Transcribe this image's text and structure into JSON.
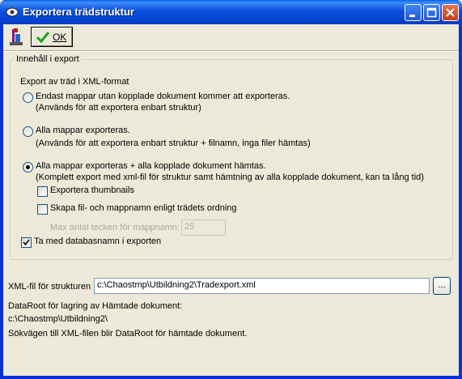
{
  "window": {
    "title": "Exportera trädstruktur",
    "minimize_icon": "minimize-icon",
    "maximize_icon": "maximize-icon",
    "close_icon": "close-icon"
  },
  "toolbar": {
    "tool_icon": "export-tool-icon",
    "ok_label": "OK",
    "ok_icon": "checkmark-icon"
  },
  "group": {
    "legend": "Innehåll i export",
    "heading": "Export av träd i XML-format",
    "options": [
      {
        "label": "Endast mappar utan kopplade dokument kommer att exporteras.",
        "note": "(Används för att exportera enbart struktur)",
        "selected": false
      },
      {
        "label": "Alla mappar exporteras.",
        "note": "(Används för att exportera enbart struktur + filnamn, inga filer hämtas)",
        "selected": false
      },
      {
        "label": "Alla mappar exporteras + alla kopplade dokument hämtas.",
        "note": "(Komplett export med xml-fil för struktur samt hämtning av alla kopplade dokument, kan ta lång tid)",
        "selected": true
      }
    ],
    "thumbnails_label": "Exportera thumbnails",
    "thumbnails_checked": false,
    "naming_label": "Skapa fil- och mappnamn enligt trädets ordning",
    "naming_checked": false,
    "max_chars_label": "Max antal tecken för mappnamn:",
    "max_chars_value": "25",
    "dbname_label": "Ta med databasnamn i exporten",
    "dbname_checked": true
  },
  "xml_file": {
    "label": "XML-fil för strukturen",
    "value": "c:\\Chaostmp\\Utbildning2\\Tradexport.xml",
    "browse_label": "..."
  },
  "dataroot": {
    "label": "DataRoot för lagring av Hämtade dokument:",
    "value": "c:\\Chaostmp\\Utbildning2\\",
    "note": "Sökvägen till XML-filen blir DataRoot för hämtade dokument."
  },
  "colors": {
    "titlebar": "#0a4fe0",
    "face": "#ece9d8",
    "check_green": "#21a121"
  }
}
